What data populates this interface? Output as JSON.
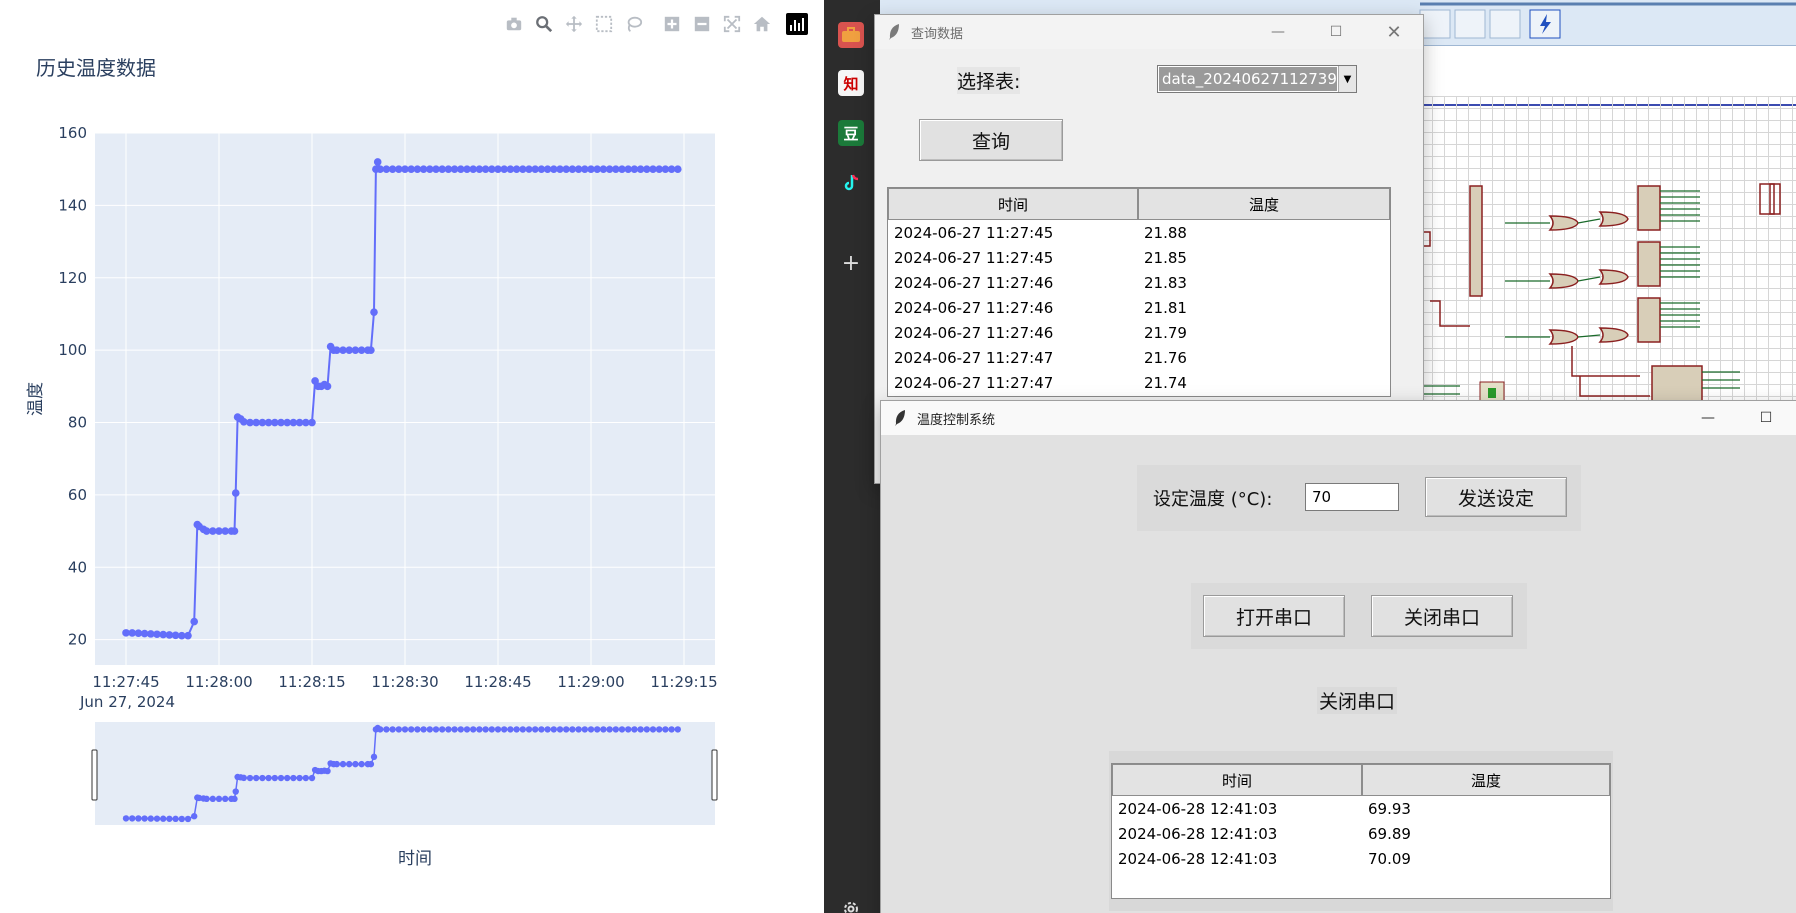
{
  "plot": {
    "title": "历史温度数据",
    "ylabel": "温度",
    "xlabel": "时间",
    "date_label": "Jun 27, 2024",
    "modebar": [
      "camera-icon",
      "zoom-icon",
      "pan-icon",
      "box-select-icon",
      "lasso-icon",
      "zoom-in-icon",
      "zoom-out-icon",
      "autoscale-icon",
      "reset-axes-icon",
      "plotly-logo-icon"
    ]
  },
  "chart_data": {
    "type": "line",
    "title": "历史温度数据",
    "xlabel": "时间",
    "ylabel": "温度",
    "x_tick_labels": [
      "11:27:45",
      "11:28:00",
      "11:28:15",
      "11:28:30",
      "11:28:45",
      "11:29:00",
      "11:29:15"
    ],
    "x_ticks_seconds": [
      45,
      60,
      75,
      90,
      105,
      120,
      135
    ],
    "y_ticks": [
      20,
      40,
      60,
      80,
      100,
      120,
      140,
      160
    ],
    "xlim_seconds": [
      40,
      140
    ],
    "ylim": [
      13,
      160
    ],
    "x_origin_label": "11:27:00",
    "color": "#636efa",
    "grid": true,
    "rangeslider": true,
    "series": [
      {
        "x": [
          45,
          46,
          47,
          48,
          49,
          50,
          51,
          52,
          53,
          54,
          55,
          56,
          56.5,
          56.8,
          57.5,
          58,
          59,
          60,
          61,
          62,
          62.5,
          62.7,
          63,
          63.5,
          64,
          65,
          66,
          67,
          68,
          69,
          70,
          71,
          72,
          73,
          74,
          75,
          75.5,
          76,
          76.5,
          77,
          77.5,
          78,
          78.5,
          79,
          80,
          81,
          82,
          83,
          84,
          84.5,
          85,
          85.3,
          85.6,
          86,
          87,
          88,
          89,
          90,
          91,
          92,
          93,
          94,
          95,
          96,
          97,
          98,
          99,
          100,
          101,
          102,
          103,
          104,
          105,
          106,
          107,
          108,
          109,
          110,
          111,
          112,
          113,
          114,
          115,
          116,
          117,
          118,
          119,
          120,
          121,
          122,
          123,
          124,
          125,
          126,
          127,
          128,
          129,
          130,
          131,
          132,
          133,
          134
        ],
        "y": [
          21.88,
          21.85,
          21.8,
          21.7,
          21.6,
          21.5,
          21.4,
          21.3,
          21.2,
          21.1,
          21.1,
          25,
          51.8,
          51.3,
          50.5,
          50,
          50,
          50,
          50,
          50,
          50,
          60.5,
          81.5,
          81,
          80.2,
          80,
          80,
          80,
          80,
          80,
          80,
          80,
          80,
          80,
          80,
          80,
          91.5,
          90,
          90,
          90.5,
          90,
          101,
          100,
          100,
          100,
          100,
          100,
          100,
          100,
          100,
          110.5,
          150,
          152,
          150,
          150,
          150,
          150,
          150,
          150,
          150,
          150,
          150,
          150,
          150,
          150,
          150,
          150,
          150,
          150,
          150,
          150,
          150,
          150,
          150,
          150,
          150,
          150,
          150,
          150,
          150,
          150,
          150,
          150,
          150,
          150,
          150,
          150,
          150,
          150,
          150,
          150,
          150,
          150,
          150,
          150,
          150,
          150,
          150,
          150,
          150,
          150,
          150
        ]
      }
    ]
  },
  "query_window": {
    "title": "查询数据",
    "select_label": "选择表:",
    "select_value": "data_20240627112739",
    "query_button": "查询",
    "columns": [
      "时间",
      "温度"
    ],
    "rows": [
      [
        "2024-06-27 11:27:45",
        "21.88"
      ],
      [
        "2024-06-27 11:27:45",
        "21.85"
      ],
      [
        "2024-06-27 11:27:46",
        "21.83"
      ],
      [
        "2024-06-27 11:27:46",
        "21.81"
      ],
      [
        "2024-06-27 11:27:46",
        "21.79"
      ],
      [
        "2024-06-27 11:27:47",
        "21.76"
      ],
      [
        "2024-06-27 11:27:47",
        "21.74"
      ]
    ]
  },
  "control_window": {
    "title": "温度控制系统",
    "set_label": "设定温度 (°C):",
    "set_value": "70",
    "send_button": "发送设定",
    "open_port_button": "打开串口",
    "close_port_button": "关闭串口",
    "status_text": "关闭串口",
    "columns": [
      "时间",
      "温度"
    ],
    "rows": [
      [
        "2024-06-28 12:41:03",
        "69.93"
      ],
      [
        "2024-06-28 12:41:03",
        "69.89"
      ],
      [
        "2024-06-28 12:41:03",
        "70.09"
      ]
    ]
  },
  "taskbar": {
    "icons": [
      "toolbox-icon",
      "zhihu-icon",
      "douban-icon",
      "tiktok-icon",
      "plus-icon",
      "settings-icon"
    ],
    "labels": {
      "zhihu": "知",
      "douban": "豆"
    }
  }
}
